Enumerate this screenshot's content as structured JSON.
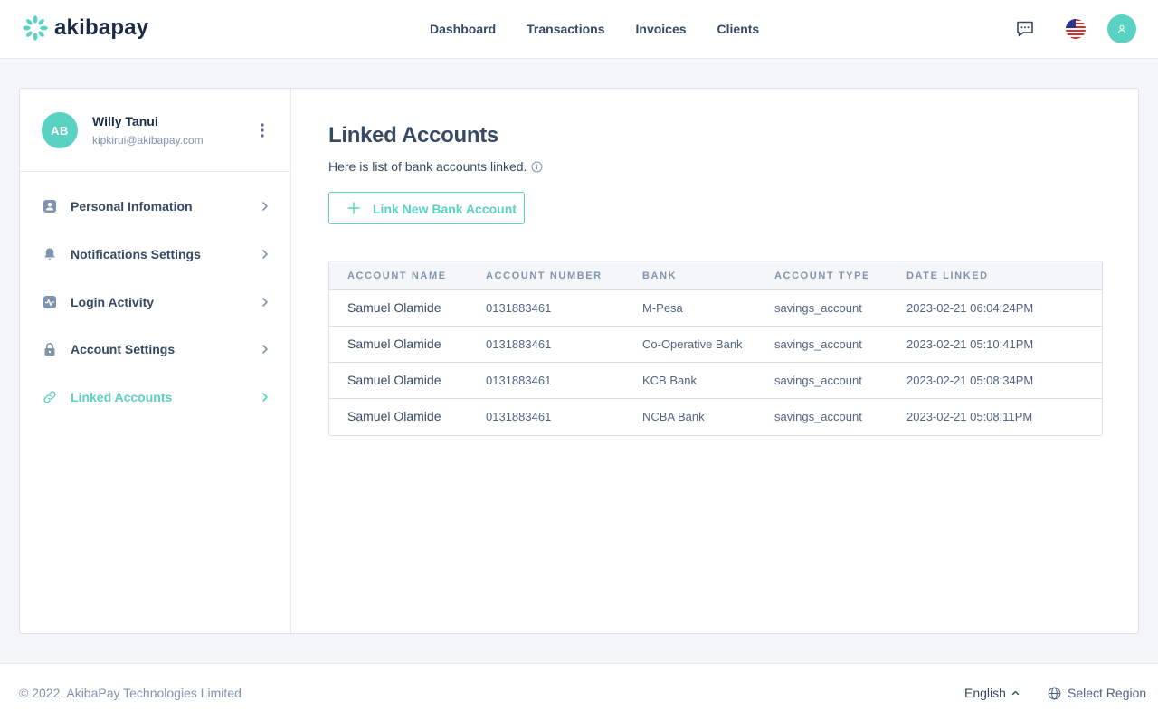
{
  "app": {
    "brand": "akibapay",
    "brand_color": "#5ad2c2"
  },
  "nav": {
    "items": [
      "Dashboard",
      "Transactions",
      "Invoices",
      "Clients"
    ]
  },
  "header_icons": [
    "chat-icon",
    "us-flag-icon",
    "user-icon"
  ],
  "user": {
    "initials": "AB",
    "name": "Willy Tanui",
    "email": "kipkirui@akibapay.com"
  },
  "sidebar": {
    "items": [
      {
        "label": "Personal Infomation",
        "icon": "user-card-icon",
        "active": false
      },
      {
        "label": "Notifications Settings",
        "icon": "bell-icon",
        "active": false
      },
      {
        "label": "Login Activity",
        "icon": "activity-icon",
        "active": false
      },
      {
        "label": "Account Settings",
        "icon": "lock-icon",
        "active": false
      },
      {
        "label": "Linked Accounts",
        "icon": "link-icon",
        "active": true
      }
    ]
  },
  "main": {
    "title": "Linked Accounts",
    "subtitle": "Here is list of bank accounts linked.",
    "link_button": "Link New Bank Account"
  },
  "table": {
    "columns": [
      "Account Name",
      "Account Number",
      "Bank",
      "Account Type",
      "Date Linked"
    ],
    "rows": [
      [
        "Samuel Olamide",
        "0131883461",
        "M-Pesa",
        "savings_account",
        "2023-02-21 06:04:24PM"
      ],
      [
        "Samuel Olamide",
        "0131883461",
        "Co-Operative Bank",
        "savings_account",
        "2023-02-21 05:10:41PM"
      ],
      [
        "Samuel Olamide",
        "0131883461",
        "KCB Bank",
        "savings_account",
        "2023-02-21 05:08:34PM"
      ],
      [
        "Samuel Olamide",
        "0131883461",
        "NCBA Bank",
        "savings_account",
        "2023-02-21 05:08:11PM"
      ]
    ]
  },
  "footer": {
    "copyright": "© 2022. AkibaPay Technologies Limited",
    "language": "English",
    "region": "Select Region"
  }
}
